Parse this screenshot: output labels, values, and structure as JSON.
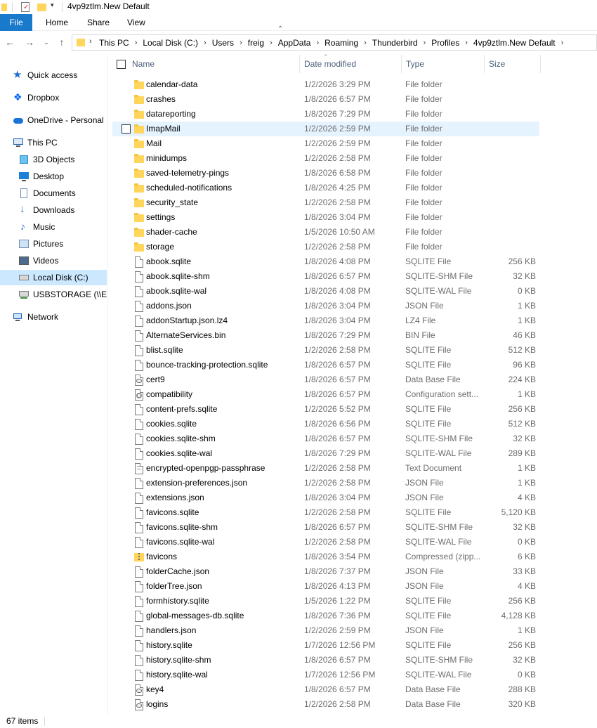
{
  "window": {
    "title": "4vp9ztlm.New Default"
  },
  "ribbon": {
    "tabs": [
      "File",
      "Home",
      "Share",
      "View"
    ]
  },
  "address": {
    "crumbs": [
      "This PC",
      "Local Disk (C:)",
      "Users",
      "freig",
      "AppData",
      "Roaming",
      "Thunderbird",
      "Profiles",
      "4vp9ztlm.New Default"
    ]
  },
  "nav": {
    "items": [
      {
        "label": "Quick access",
        "icon": "star-icon"
      },
      {
        "label": "Dropbox",
        "icon": "dropbox-icon"
      },
      {
        "label": "OneDrive - Personal",
        "icon": "cloud-icon"
      },
      {
        "label": "This PC",
        "icon": "computer-icon"
      },
      {
        "label": "3D Objects",
        "icon": "cube-icon"
      },
      {
        "label": "Desktop",
        "icon": "desktop-icon"
      },
      {
        "label": "Documents",
        "icon": "documents-icon"
      },
      {
        "label": "Downloads",
        "icon": "download-arrow-icon"
      },
      {
        "label": "Music",
        "icon": "music-note-icon"
      },
      {
        "label": "Pictures",
        "icon": "pictures-icon"
      },
      {
        "label": "Videos",
        "icon": "videos-icon"
      },
      {
        "label": "Local Disk (C:)",
        "icon": "drive-icon"
      },
      {
        "label": "USBSTORAGE (\\\\EPS",
        "icon": "network-drive-icon"
      },
      {
        "label": "Network",
        "icon": "network-icon"
      }
    ]
  },
  "columns": {
    "name": "Name",
    "date": "Date modified",
    "type": "Type",
    "size": "Size"
  },
  "files": [
    {
      "name": "calendar-data",
      "date": "1/2/2026 3:29 PM",
      "type": "File folder",
      "size": "",
      "icon": "folder"
    },
    {
      "name": "crashes",
      "date": "1/8/2026 6:57 PM",
      "type": "File folder",
      "size": "",
      "icon": "folder"
    },
    {
      "name": "datareporting",
      "date": "1/8/2026 7:29 PM",
      "type": "File folder",
      "size": "",
      "icon": "folder"
    },
    {
      "name": "ImapMail",
      "date": "1/2/2026 2:59 PM",
      "type": "File folder",
      "size": "",
      "icon": "folder"
    },
    {
      "name": "Mail",
      "date": "1/2/2026 2:59 PM",
      "type": "File folder",
      "size": "",
      "icon": "folder"
    },
    {
      "name": "minidumps",
      "date": "1/2/2026 2:58 PM",
      "type": "File folder",
      "size": "",
      "icon": "folder"
    },
    {
      "name": "saved-telemetry-pings",
      "date": "1/8/2026 6:58 PM",
      "type": "File folder",
      "size": "",
      "icon": "folder"
    },
    {
      "name": "scheduled-notifications",
      "date": "1/8/2026 4:25 PM",
      "type": "File folder",
      "size": "",
      "icon": "folder"
    },
    {
      "name": "security_state",
      "date": "1/2/2026 2:58 PM",
      "type": "File folder",
      "size": "",
      "icon": "folder"
    },
    {
      "name": "settings",
      "date": "1/8/2026 3:04 PM",
      "type": "File folder",
      "size": "",
      "icon": "folder"
    },
    {
      "name": "shader-cache",
      "date": "1/5/2026 10:50 AM",
      "type": "File folder",
      "size": "",
      "icon": "folder"
    },
    {
      "name": "storage",
      "date": "1/2/2026 2:58 PM",
      "type": "File folder",
      "size": "",
      "icon": "folder"
    },
    {
      "name": "abook.sqlite",
      "date": "1/8/2026 4:08 PM",
      "type": "SQLITE File",
      "size": "256 KB",
      "icon": "doc"
    },
    {
      "name": "abook.sqlite-shm",
      "date": "1/8/2026 6:57 PM",
      "type": "SQLITE-SHM File",
      "size": "32 KB",
      "icon": "doc"
    },
    {
      "name": "abook.sqlite-wal",
      "date": "1/8/2026 4:08 PM",
      "type": "SQLITE-WAL File",
      "size": "0 KB",
      "icon": "doc"
    },
    {
      "name": "addons.json",
      "date": "1/8/2026 3:04 PM",
      "type": "JSON File",
      "size": "1 KB",
      "icon": "doc"
    },
    {
      "name": "addonStartup.json.lz4",
      "date": "1/8/2026 3:04 PM",
      "type": "LZ4 File",
      "size": "1 KB",
      "icon": "doc"
    },
    {
      "name": "AlternateServices.bin",
      "date": "1/8/2026 7:29 PM",
      "type": "BIN File",
      "size": "46 KB",
      "icon": "doc"
    },
    {
      "name": "blist.sqlite",
      "date": "1/2/2026 2:58 PM",
      "type": "SQLITE File",
      "size": "512 KB",
      "icon": "doc"
    },
    {
      "name": "bounce-tracking-protection.sqlite",
      "date": "1/8/2026 6:57 PM",
      "type": "SQLITE File",
      "size": "96 KB",
      "icon": "doc"
    },
    {
      "name": "cert9",
      "date": "1/8/2026 6:57 PM",
      "type": "Data Base File",
      "size": "224 KB",
      "icon": "db"
    },
    {
      "name": "compatibility",
      "date": "1/8/2026 6:57 PM",
      "type": "Configuration sett...",
      "size": "1 KB",
      "icon": "gear"
    },
    {
      "name": "content-prefs.sqlite",
      "date": "1/2/2026 5:52 PM",
      "type": "SQLITE File",
      "size": "256 KB",
      "icon": "doc"
    },
    {
      "name": "cookies.sqlite",
      "date": "1/8/2026 6:56 PM",
      "type": "SQLITE File",
      "size": "512 KB",
      "icon": "doc"
    },
    {
      "name": "cookies.sqlite-shm",
      "date": "1/8/2026 6:57 PM",
      "type": "SQLITE-SHM File",
      "size": "32 KB",
      "icon": "doc"
    },
    {
      "name": "cookies.sqlite-wal",
      "date": "1/8/2026 7:29 PM",
      "type": "SQLITE-WAL File",
      "size": "289 KB",
      "icon": "doc"
    },
    {
      "name": "encrypted-openpgp-passphrase",
      "date": "1/2/2026 2:58 PM",
      "type": "Text Document",
      "size": "1 KB",
      "icon": "text"
    },
    {
      "name": "extension-preferences.json",
      "date": "1/2/2026 2:58 PM",
      "type": "JSON File",
      "size": "1 KB",
      "icon": "doc"
    },
    {
      "name": "extensions.json",
      "date": "1/8/2026 3:04 PM",
      "type": "JSON File",
      "size": "4 KB",
      "icon": "doc"
    },
    {
      "name": "favicons.sqlite",
      "date": "1/2/2026 2:58 PM",
      "type": "SQLITE File",
      "size": "5,120 KB",
      "icon": "doc"
    },
    {
      "name": "favicons.sqlite-shm",
      "date": "1/8/2026 6:57 PM",
      "type": "SQLITE-SHM File",
      "size": "32 KB",
      "icon": "doc"
    },
    {
      "name": "favicons.sqlite-wal",
      "date": "1/2/2026 2:58 PM",
      "type": "SQLITE-WAL File",
      "size": "0 KB",
      "icon": "doc"
    },
    {
      "name": "favicons",
      "date": "1/8/2026 3:54 PM",
      "type": "Compressed (zipp...",
      "size": "6 KB",
      "icon": "zip"
    },
    {
      "name": "folderCache.json",
      "date": "1/8/2026 7:37 PM",
      "type": "JSON File",
      "size": "33 KB",
      "icon": "doc"
    },
    {
      "name": "folderTree.json",
      "date": "1/8/2026 4:13 PM",
      "type": "JSON File",
      "size": "4 KB",
      "icon": "doc"
    },
    {
      "name": "formhistory.sqlite",
      "date": "1/5/2026 1:22 PM",
      "type": "SQLITE File",
      "size": "256 KB",
      "icon": "doc"
    },
    {
      "name": "global-messages-db.sqlite",
      "date": "1/8/2026 7:36 PM",
      "type": "SQLITE File",
      "size": "4,128 KB",
      "icon": "doc"
    },
    {
      "name": "handlers.json",
      "date": "1/2/2026 2:59 PM",
      "type": "JSON File",
      "size": "1 KB",
      "icon": "doc"
    },
    {
      "name": "history.sqlite",
      "date": "1/7/2026 12:56 PM",
      "type": "SQLITE File",
      "size": "256 KB",
      "icon": "doc"
    },
    {
      "name": "history.sqlite-shm",
      "date": "1/8/2026 6:57 PM",
      "type": "SQLITE-SHM File",
      "size": "32 KB",
      "icon": "doc"
    },
    {
      "name": "history.sqlite-wal",
      "date": "1/7/2026 12:56 PM",
      "type": "SQLITE-WAL File",
      "size": "0 KB",
      "icon": "doc"
    },
    {
      "name": "key4",
      "date": "1/8/2026 6:57 PM",
      "type": "Data Base File",
      "size": "288 KB",
      "icon": "db"
    },
    {
      "name": "logins",
      "date": "1/2/2026 2:58 PM",
      "type": "Data Base File",
      "size": "320 KB",
      "icon": "db"
    }
  ],
  "hovered_file": "ImapMail",
  "status": {
    "item_count": "67 items"
  }
}
